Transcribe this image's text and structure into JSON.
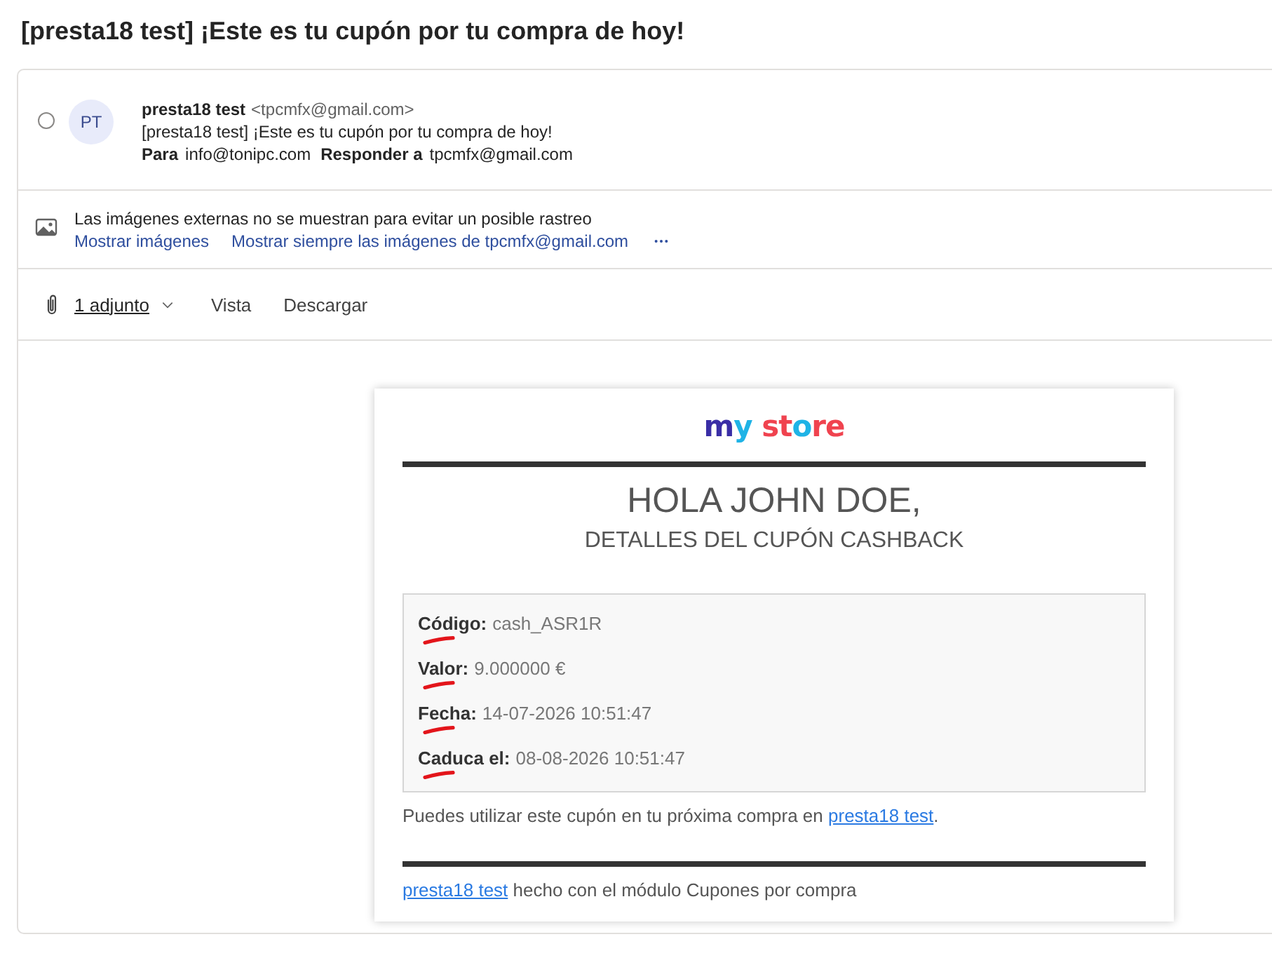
{
  "title": "[presta18 test] ¡Este es tu cupón por tu compra de hoy!",
  "message": {
    "selected": false,
    "avatar_initials": "PT",
    "sender_name": "presta18 test",
    "sender_email": "<tpcmfx@gmail.com>",
    "subject": "[presta18 test] ¡Este es tu cupón por tu compra de hoy!",
    "to_label": "Para",
    "to": "info@tonipc.com",
    "reply_label": "Responder a",
    "reply_to": "tpcmfx@gmail.com"
  },
  "images_notice": {
    "text": "Las imágenes externas no se muestran para evitar un posible rastreo",
    "links": [
      "Mostrar imágenes",
      "Mostrar siempre las imágenes de tpcmfx@gmail.com"
    ]
  },
  "attachments": {
    "label": "1 adjunto",
    "actions": [
      "Vista",
      "Descargar"
    ]
  },
  "email": {
    "logo": "my store",
    "greeting": "HOLA JOHN DOE,",
    "subtitle": "DETALLES DEL CUPÓN CASHBACK",
    "details": [
      {
        "label": "Código:",
        "value": "cash_ASR1R",
        "marked": true
      },
      {
        "label": "Valor:",
        "value": "9.000000 €",
        "marked": true
      },
      {
        "label": "Fecha:",
        "value": "14-07-2026 10:51:47",
        "marked": true
      },
      {
        "label": "Caduca el:",
        "value": "08-08-2026 10:51:47",
        "marked": true
      }
    ],
    "note": {
      "text": "Puedes utilizar este cupón en tu próxima compra en ",
      "link": "presta18 test",
      "end": "."
    },
    "footer": {
      "link": "presta18 test",
      "text": " hecho con el módulo Cupones por compra"
    }
  }
}
